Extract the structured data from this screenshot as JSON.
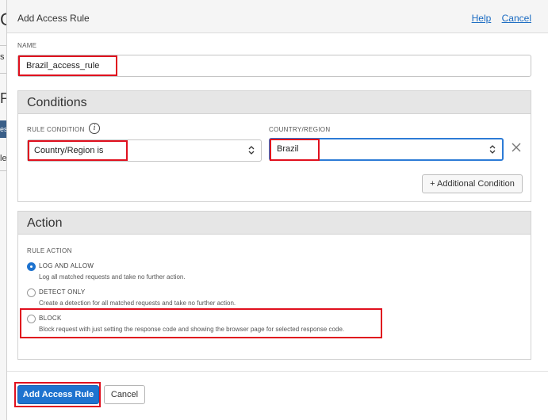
{
  "background_page": {
    "fragments": [
      "Co",
      "s",
      "P",
      "es",
      "le"
    ]
  },
  "dialog": {
    "title": "Add Access Rule",
    "help_link": "Help",
    "cancel_link": "Cancel"
  },
  "name_field": {
    "label": "NAME",
    "value": "Brazil_access_rule"
  },
  "conditions": {
    "heading": "Conditions",
    "rule_condition_label": "RULE CONDITION",
    "rule_condition_info_icon": "i",
    "rule_condition_value": "Country/Region is",
    "country_label": "COUNTRY/REGION",
    "country_value": "Brazil",
    "additional_condition_button": "+ Additional Condition"
  },
  "action": {
    "heading": "Action",
    "rule_action_label": "RULE ACTION",
    "options": [
      {
        "title": "LOG AND ALLOW",
        "description": "Log all matched requests and take no further action.",
        "checked": true
      },
      {
        "title": "DETECT ONLY",
        "description": "Create a detection for all matched requests and take no further action.",
        "checked": false
      },
      {
        "title": "BLOCK",
        "description": "Block request with just setting the response code and showing the browser page for selected response code.",
        "checked": false
      }
    ]
  },
  "footer": {
    "primary_button": "Add Access Rule",
    "cancel_button": "Cancel"
  },
  "colors": {
    "primary": "#1e73cf",
    "link": "#1a6bc2",
    "highlight": "#e0101e"
  }
}
